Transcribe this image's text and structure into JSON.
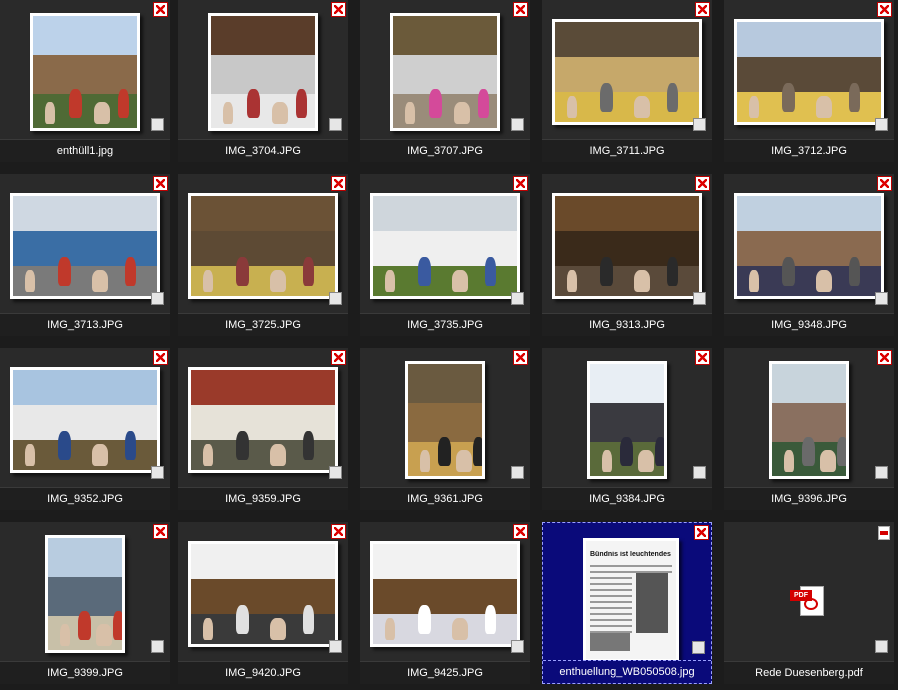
{
  "files": [
    {
      "name": "enthüll1.jpg",
      "kind": "photo",
      "orient": "landscape",
      "colors": [
        "#bcd2ea",
        "#8a6a4a",
        "#4f6a35"
      ],
      "fig": "#c0392b"
    },
    {
      "name": "IMG_3704.JPG",
      "kind": "photo",
      "orient": "landscape",
      "colors": [
        "#5a3d2a",
        "#c8c8c8",
        "#e8e8e8"
      ],
      "fig": "#a33"
    },
    {
      "name": "IMG_3707.JPG",
      "kind": "photo",
      "orient": "landscape",
      "colors": [
        "#6b5a3a",
        "#cfcfcf",
        "#9a8c7a"
      ],
      "fig": "#d44a9a"
    },
    {
      "name": "IMG_3711.JPG",
      "kind": "photo",
      "orient": "landscape",
      "colors": [
        "#5a4b38",
        "#c6a86a",
        "#d8b84a"
      ],
      "fig": "#6b6b6b"
    },
    {
      "name": "IMG_3712.JPG",
      "kind": "photo",
      "orient": "landscape",
      "colors": [
        "#b7c9de",
        "#5a4a38",
        "#e0c050"
      ],
      "fig": "#7a6a5a"
    },
    {
      "name": "IMG_3713.JPG",
      "kind": "photo",
      "orient": "landscape",
      "colors": [
        "#cfd8e2",
        "#3a6ea5",
        "#7a7a7a"
      ],
      "fig": "#c0392b"
    },
    {
      "name": "IMG_3725.JPG",
      "kind": "photo",
      "orient": "landscape",
      "colors": [
        "#6b5236",
        "#5d4a34",
        "#c8b050"
      ],
      "fig": "#8a3a3a"
    },
    {
      "name": "IMG_3735.JPG",
      "kind": "photo",
      "orient": "landscape",
      "colors": [
        "#cfd6dc",
        "#efefef",
        "#5a7a30"
      ],
      "fig": "#3a5aa0"
    },
    {
      "name": "IMG_9313.JPG",
      "kind": "photo",
      "orient": "landscape",
      "colors": [
        "#6a4a2a",
        "#3a2a1a",
        "#5a4a3a"
      ],
      "fig": "#2a2a2a"
    },
    {
      "name": "IMG_9348.JPG",
      "kind": "photo",
      "orient": "landscape",
      "colors": [
        "#c0d0e0",
        "#8a6a50",
        "#3a3a55"
      ],
      "fig": "#555"
    },
    {
      "name": "IMG_9352.JPG",
      "kind": "photo",
      "orient": "landscape",
      "colors": [
        "#a8c4e0",
        "#e8e8e8",
        "#6a5a3a"
      ],
      "fig": "#2a4a8a"
    },
    {
      "name": "IMG_9359.JPG",
      "kind": "photo",
      "orient": "landscape",
      "colors": [
        "#9a3a2a",
        "#e6e2d8",
        "#5a5a4a"
      ],
      "fig": "#333"
    },
    {
      "name": "IMG_9361.JPG",
      "kind": "photo",
      "orient": "portrait",
      "colors": [
        "#6a5a40",
        "#8a6a40",
        "#c8a050"
      ],
      "fig": "#222"
    },
    {
      "name": "IMG_9384.JPG",
      "kind": "photo",
      "orient": "portrait",
      "colors": [
        "#e8eef4",
        "#3a3a40",
        "#5a6a3a"
      ],
      "fig": "#2a2a3a"
    },
    {
      "name": "IMG_9396.JPG",
      "kind": "photo",
      "orient": "portrait",
      "colors": [
        "#c8d4dc",
        "#8a7060",
        "#3a5a3a"
      ],
      "fig": "#6a6a6a"
    },
    {
      "name": "IMG_9399.JPG",
      "kind": "photo",
      "orient": "portrait",
      "colors": [
        "#b8cce0",
        "#5a6a7a",
        "#c8c0a8"
      ],
      "fig": "#c0392b"
    },
    {
      "name": "IMG_9420.JPG",
      "kind": "photo",
      "orient": "landscape",
      "colors": [
        "#f0f0f0",
        "#6a4a2a",
        "#3a3a3a"
      ],
      "fig": "#e0e0e0"
    },
    {
      "name": "IMG_9425.JPG",
      "kind": "photo",
      "orient": "landscape",
      "colors": [
        "#f2f2f2",
        "#6a4a2a",
        "#d8d8e0"
      ],
      "fig": "#ffffff"
    },
    {
      "name": "enthuellung_WB050508.jpg",
      "kind": "document",
      "selected": true,
      "headline": "Bündnis ist leuchtendes Vorbild"
    },
    {
      "name": "Rede Duesenberg.pdf",
      "kind": "pdf",
      "pdf_tag": "PDF"
    }
  ]
}
